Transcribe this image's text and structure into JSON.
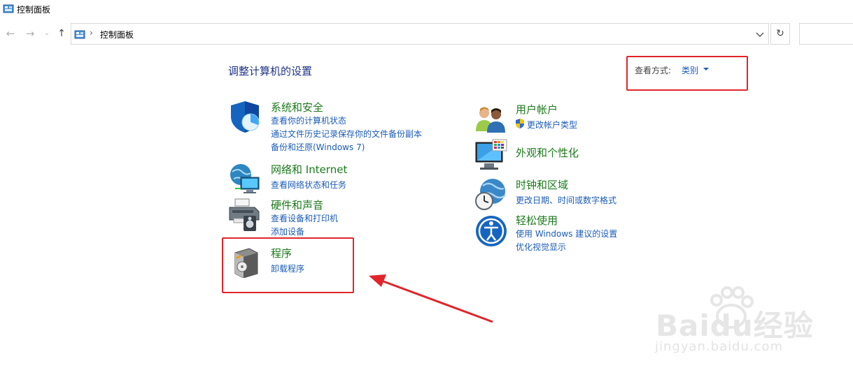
{
  "window": {
    "title": "控制面板"
  },
  "address_bar": {
    "breadcrumb": "控制面板"
  },
  "main": {
    "heading": "调整计算机的设置",
    "view_by": {
      "label": "查看方式:",
      "value": "类别"
    }
  },
  "categories": {
    "system_security": {
      "title": "系统和安全",
      "links": [
        "查看你的计算机状态",
        "通过文件历史记录保存你的文件备份副本",
        "备份和还原(Windows 7)"
      ]
    },
    "network": {
      "title": "网络和 Internet",
      "links": [
        "查看网络状态和任务"
      ]
    },
    "hardware": {
      "title": "硬件和声音",
      "links": [
        "查看设备和打印机",
        "添加设备"
      ]
    },
    "programs": {
      "title": "程序",
      "links": [
        "卸载程序"
      ]
    },
    "user_accounts": {
      "title": "用户帐户",
      "links": [
        "更改帐户类型"
      ]
    },
    "appearance": {
      "title": "外观和个性化",
      "links": []
    },
    "clock_region": {
      "title": "时钟和区域",
      "links": [
        "更改日期、时间或数字格式"
      ]
    },
    "ease_of_access": {
      "title": "轻松使用",
      "links": [
        "使用 Windows 建议的设置",
        "优化视觉显示"
      ]
    }
  },
  "watermark": {
    "brand": "Baidu经验",
    "url": "jingyan.baidu.com"
  },
  "colors": {
    "link": "#1c5cb8",
    "category_title": "#1a7a1a",
    "annotation": "#e0262b"
  },
  "icons": [
    "control-panel-icon",
    "back-arrow-icon",
    "forward-arrow-icon",
    "recent-chevron-icon",
    "up-arrow-icon",
    "chevron-down-icon",
    "refresh-icon",
    "shield-icon",
    "globe-network-icon",
    "printer-icon",
    "program-box-icon",
    "users-icon",
    "uac-shield-icon",
    "monitor-palette-icon",
    "clock-globe-icon",
    "ease-access-icon"
  ]
}
